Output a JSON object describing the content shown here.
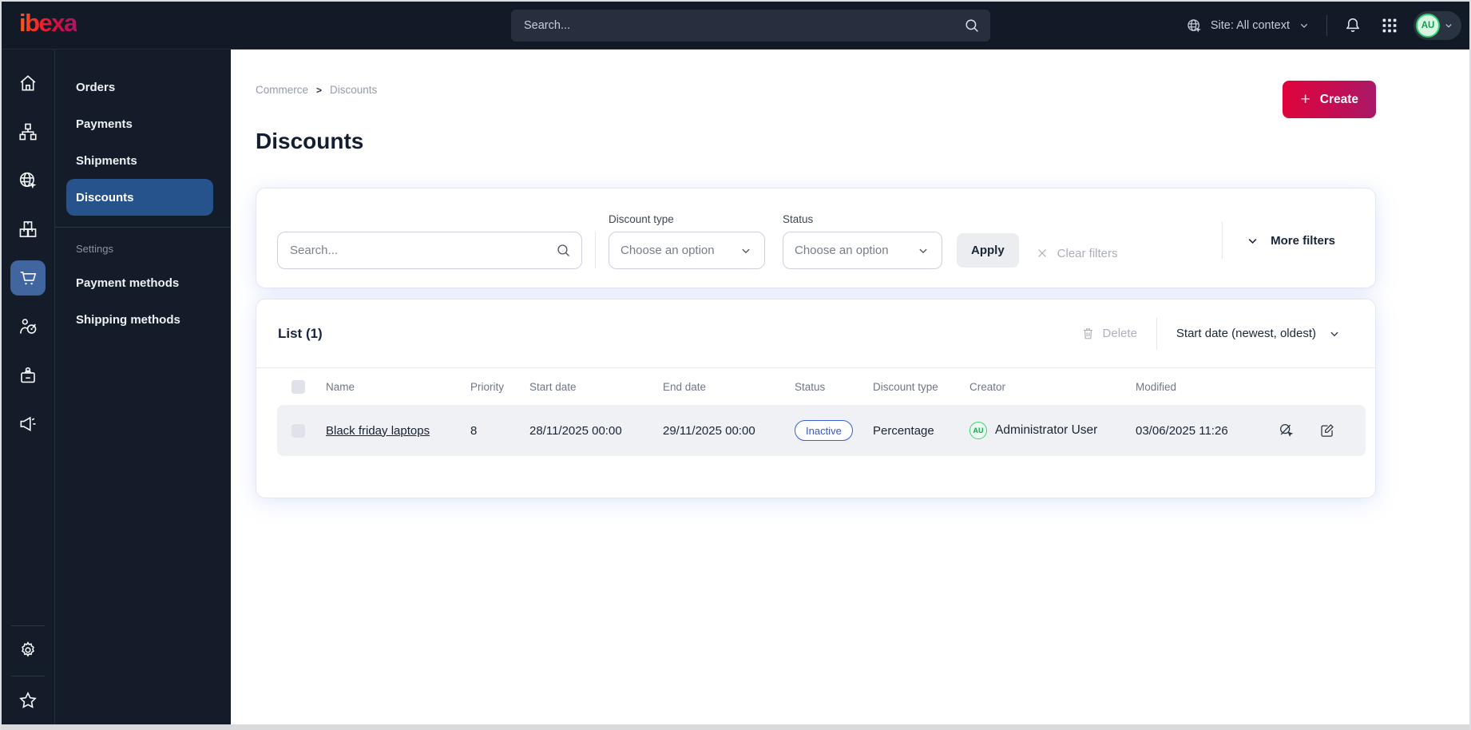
{
  "topbar": {
    "logo_text": "ibexa",
    "search_placeholder": "Search...",
    "site_context": "Site: All context",
    "avatar_initials": "AU"
  },
  "sidebar": {
    "rail_icons": [
      "home",
      "sitemap",
      "site-globe",
      "product-catalog",
      "commerce-cart",
      "customers-target",
      "corporate-badge",
      "marketing-megaphone",
      "settings-gear",
      "bookmarks-star"
    ],
    "active_rail": "commerce-cart",
    "menu": {
      "items": [
        "Orders",
        "Payments",
        "Shipments",
        "Discounts"
      ],
      "active_item": "Discounts",
      "section_label": "Settings",
      "settings_items": [
        "Payment methods",
        "Shipping methods"
      ]
    }
  },
  "breadcrumb": {
    "items": [
      "Commerce",
      "Discounts"
    ]
  },
  "page": {
    "title": "Discounts",
    "create_label": "Create"
  },
  "filters": {
    "search_placeholder": "Search...",
    "discount_type_label": "Discount type",
    "discount_type_value": "Choose an option",
    "status_label": "Status",
    "status_value": "Choose an option",
    "apply_label": "Apply",
    "clear_label": "Clear filters",
    "more_label": "More filters"
  },
  "list": {
    "title": "List (1)",
    "delete_label": "Delete",
    "sort_label": "Start date (newest, oldest)",
    "columns": [
      "Name",
      "Priority",
      "Start date",
      "End date",
      "Status",
      "Discount type",
      "Creator",
      "Modified"
    ],
    "rows": [
      {
        "name": "Black friday laptops",
        "priority": "8",
        "start_date": "28/11/2025 00:00",
        "end_date": "29/11/2025 00:00",
        "status": "Inactive",
        "discount_type": "Percentage",
        "creator": "Administrator User",
        "creator_initials": "AU",
        "modified": "03/06/2025 11:26"
      }
    ]
  },
  "colors": {
    "topbar_bg": "#131A27",
    "active_menu_blue": "#26538C",
    "active_rail_blue": "#40659F",
    "create_gradient_start": "#E0043C",
    "create_gradient_end": "#A81A68",
    "badge_blue": "#3A5FD0",
    "avatar_green": "#2FCF6E"
  }
}
